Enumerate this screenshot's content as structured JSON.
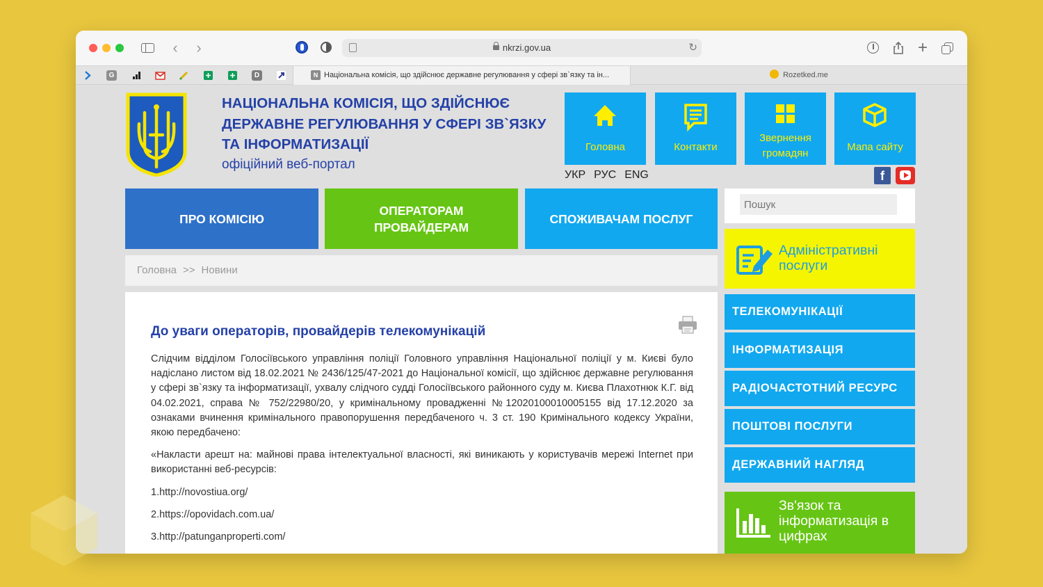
{
  "browser": {
    "url": "nkrzi.gov.ua",
    "tabs": [
      {
        "label": "Національна комісія, що здійснює державне регулювання у сфері зв`язку та ін...",
        "active": true
      },
      {
        "label": "Rozetked.me",
        "active": false
      }
    ],
    "bookmarks": [
      "arrow-icon",
      "g-icon",
      "signal-icon",
      "gmail-icon",
      "pen-icon",
      "sheets-icon",
      "sheets-icon",
      "d-icon",
      "app-icon"
    ],
    "favicon_letter": "N",
    "bookmark_g": "G",
    "bookmark_d": "D"
  },
  "header": {
    "title": "НАЦІОНАЛЬНА КОМІСІЯ, ЩО ЗДІЙСНЮЄ ДЕРЖАВНЕ РЕГУЛЮВАННЯ У СФЕРІ ЗВ`ЯЗКУ ТА ІНФОРМАТИЗАЦІЇ",
    "subtitle": "офіційний веб-портал",
    "top_buttons": [
      {
        "label": "Головна",
        "icon": "home-icon"
      },
      {
        "label": "Контакти",
        "icon": "note-icon"
      },
      {
        "label": "Звернення громадян",
        "icon": "grid-icon"
      },
      {
        "label": "Мапа сайту",
        "icon": "cube-icon"
      }
    ],
    "languages": [
      "УКР",
      "РУС",
      "ENG"
    ],
    "social": {
      "facebook": "f"
    }
  },
  "nav": {
    "items": [
      "ПРО КОМІСІЮ",
      "ОПЕРАТОРАМ ПРОВАЙДЕРАМ",
      "СПОЖИВАЧАМ ПОСЛУГ"
    ]
  },
  "breadcrumb": {
    "home": "Головна",
    "separator": ">>",
    "current": "Новини"
  },
  "article": {
    "title": "До уваги операторів, провайдерів телекомунікацій",
    "paragraphs": [
      "Слідчим відділом Голосіївського управління поліції Головного управління Національної поліції у м. Києві було надіслано листом від 18.02.2021 № 2436/125/47-2021 до Національної комісії, що здійснює державне регулювання у сфері зв`язку та інформатизації, ухвалу слідчого судді Голосіївського районного суду м. Києва Плахотнюк К.Г. від 04.02.2021, справа № 752/22980/20, у кримінальному провадженні №12020100010005155 від 17.12.2020 за ознаками вчинення кримінального правопорушення передбаченого ч. 3 ст. 190 Кримінального кодексу України, якою передбачено:",
      "«Накласти арешт на: майнові права інтелектуальної власності, які виникають у користувачів мережі Internet при використанні веб-ресурсів:",
      "1.http://novostiua.org/",
      "2.https://opovidach.com.ua/",
      "3.http://patunganproperti.com/"
    ]
  },
  "sidebar": {
    "search_placeholder": "Пошук",
    "admin_services": "Адміністративні послуги",
    "items": [
      "ТЕЛЕКОМУНІКАЦІЇ",
      "ІНФОРМАТИЗАЦІЯ",
      "РАДІОЧАСТОТНИЙ РЕСУРС",
      "ПОШТОВІ ПОСЛУГИ",
      "ДЕРЖАВНИЙ НАГЛЯД"
    ],
    "stats": "Зв'язок та інформатизація в цифрах"
  },
  "colors": {
    "background": "#e8c63e",
    "title_blue": "#2441a7",
    "cyan": "#11a8ef",
    "green": "#66c514",
    "dark_blue": "#2e71c9",
    "yellow": "#f5f500",
    "icon_yellow": "#ffee00"
  }
}
